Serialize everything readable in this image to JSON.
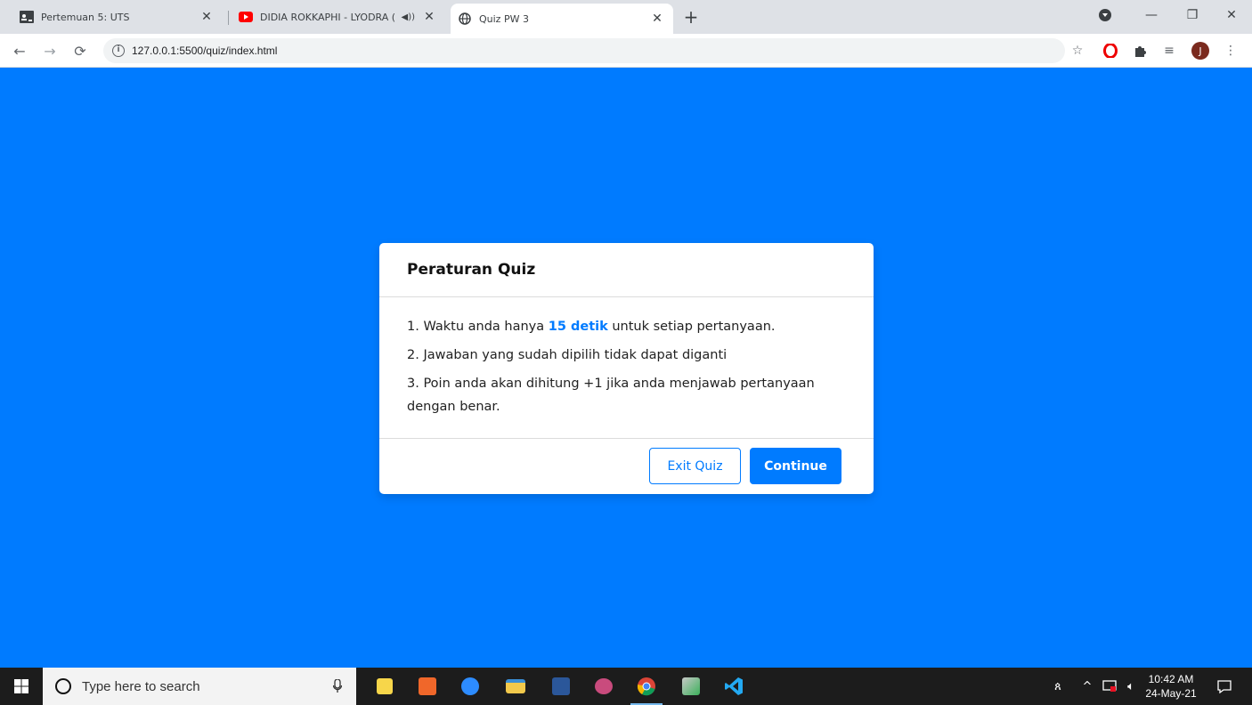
{
  "browser": {
    "tabs": [
      {
        "title": "Pertemuan 5: UTS",
        "icon": "classroom-icon",
        "active": false
      },
      {
        "title": "DIDIA ROKKAPHI - LYODRA (",
        "icon": "youtube-icon",
        "active": false,
        "audio": true
      },
      {
        "title": "Quiz PW 3",
        "icon": "globe-icon",
        "active": true
      }
    ],
    "url": "127.0.0.1:5500/quiz/index.html",
    "profile_initial": "J"
  },
  "modal": {
    "title": "Peraturan Quiz",
    "rules": [
      {
        "prefix": "1. Waktu anda hanya ",
        "highlight": "15 detik",
        "suffix": " untuk setiap pertanyaan."
      },
      {
        "text": "2. Jawaban yang sudah dipilih tidak dapat diganti"
      },
      {
        "text": "3. Poin anda akan dihitung +1 jika anda menjawab pertanyaan dengan benar."
      }
    ],
    "exit_label": "Exit Quiz",
    "continue_label": "Continue"
  },
  "taskbar": {
    "search_placeholder": "Type here to search",
    "time": "10:42 AM",
    "date": "24-May-21"
  },
  "colors": {
    "page_background": "#007bff",
    "accent": "#007bff",
    "tabstrip": "#dee1e6",
    "taskbar": "#1c1c1c"
  }
}
